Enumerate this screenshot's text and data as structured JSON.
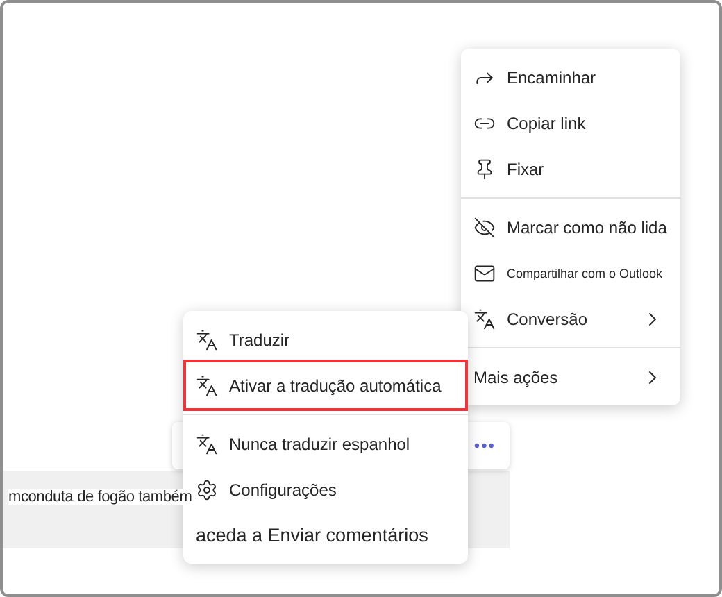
{
  "message": {
    "text": "mconduta de fogão também",
    "more": "•••"
  },
  "menu": {
    "groups": [
      [
        {
          "label": "Encaminhar",
          "submenu": false
        },
        {
          "label": "Copiar link",
          "submenu": false
        },
        {
          "label": "Fixar",
          "submenu": false
        }
      ],
      [
        {
          "label": "Marcar como não lida",
          "submenu": false
        },
        {
          "label": "Compartilhar com o Outlook",
          "submenu": false
        },
        {
          "label": "Conversão",
          "submenu": true
        }
      ],
      [
        {
          "label": "Mais ações",
          "submenu": true
        }
      ]
    ]
  },
  "submenu": {
    "groups": [
      [
        {
          "label": "Traduzir",
          "highlighted": false
        },
        {
          "label": "Ativar a tradução automática",
          "highlighted": true
        }
      ],
      [
        {
          "label": "Nunca traduzir espanhol",
          "highlighted": false
        },
        {
          "label": "Configurações",
          "highlighted": false
        },
        {
          "label": "aceda a Enviar comentários",
          "highlighted": false
        }
      ]
    ]
  }
}
